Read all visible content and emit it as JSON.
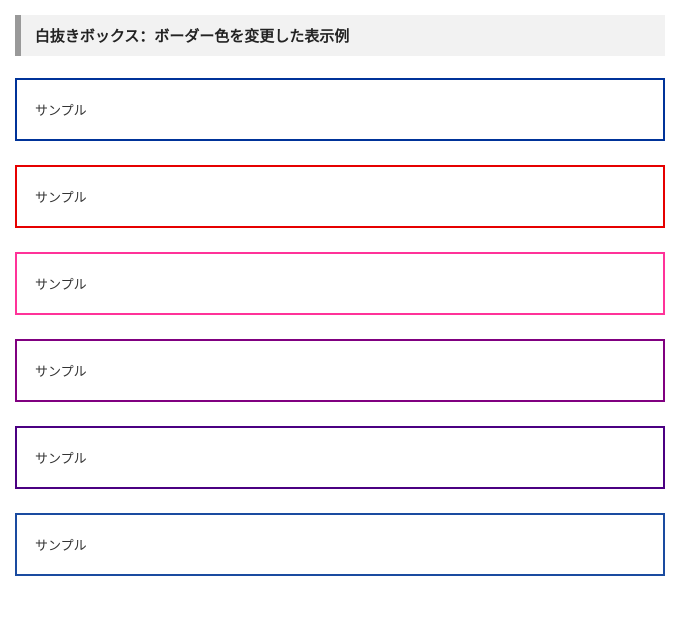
{
  "heading": {
    "title": "白抜きボックス：ボーダー色を変更した表示例"
  },
  "boxes": [
    {
      "label": "サンプル",
      "border_color": "#003399"
    },
    {
      "label": "サンプル",
      "border_color": "#e60000"
    },
    {
      "label": "サンプル",
      "border_color": "#ff3399"
    },
    {
      "label": "サンプル",
      "border_color": "#800080"
    },
    {
      "label": "サンプル",
      "border_color": "#4b0082"
    },
    {
      "label": "サンプル",
      "border_color": "#1a4ba0"
    }
  ]
}
